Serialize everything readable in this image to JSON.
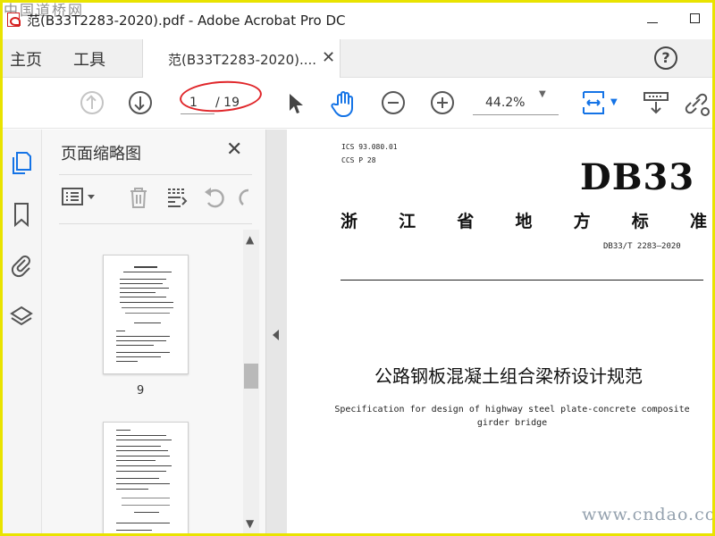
{
  "watermark": {
    "top": "中国道桥网",
    "bottom": "www.cndao.com"
  },
  "window": {
    "title": "范(B33T2283-2020).pdf - Adobe Acrobat Pro DC"
  },
  "tabs": {
    "home": "主页",
    "tools": "工具",
    "document": "范(B33T2283-2020)...."
  },
  "toolbar": {
    "current_page": "1",
    "page_total": "/ 19",
    "zoom": "44.2%"
  },
  "thumbnail_panel": {
    "title": "页面缩略图",
    "pages": [
      {
        "label": "9"
      }
    ]
  },
  "document": {
    "ics": "ICS 93.080.01",
    "ccs": "CCS P 28",
    "big_code": "DB33",
    "standard_type_chars": [
      "浙",
      "江",
      "省",
      "地",
      "方",
      "标",
      "准"
    ],
    "standard_number": "DB33/T 2283—2020",
    "title_cn": "公路钢板混凝土组合梁桥设计规范",
    "title_en": "Specification for design of highway steel plate-concrete composite girder bridge"
  },
  "colors": {
    "accent": "#1473e6",
    "highlight_ellipse": "#e0262a",
    "frame": "#e9e300"
  },
  "icons": [
    "pdf-app-icon",
    "help-icon",
    "prev-page-icon",
    "next-page-icon",
    "select-cursor-icon",
    "hand-icon",
    "zoom-out-icon",
    "zoom-in-icon",
    "fit-page-icon",
    "scroll-mode-icon",
    "share-link-icon",
    "pages-icon",
    "bookmark-icon",
    "attachment-icon",
    "layers-icon",
    "options-menu-icon",
    "delete-icon",
    "extract-icon",
    "undo-icon",
    "redo-icon"
  ]
}
